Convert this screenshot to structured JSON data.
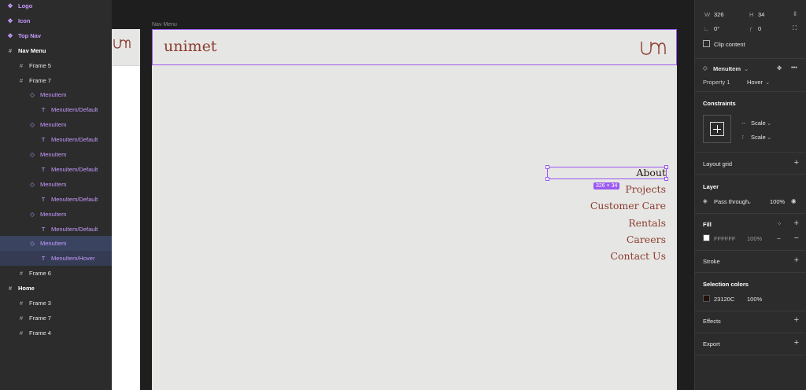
{
  "layers": {
    "items": [
      {
        "label": "Logo",
        "kind": "component",
        "indent": 0
      },
      {
        "label": "Icon",
        "kind": "component",
        "indent": 0
      },
      {
        "label": "Top Nav",
        "kind": "component",
        "indent": 0
      },
      {
        "label": "Nav Menu",
        "kind": "frame",
        "indent": 0
      },
      {
        "label": "Frame 5",
        "kind": "frame",
        "indent": 1
      },
      {
        "label": "Frame 7",
        "kind": "frame",
        "indent": 1
      },
      {
        "label": "MenuItem",
        "kind": "instance",
        "indent": 2
      },
      {
        "label": "MenuItem/Default",
        "kind": "text",
        "indent": 3
      },
      {
        "label": "MenuItem",
        "kind": "instance",
        "indent": 2
      },
      {
        "label": "MenuItem/Default",
        "kind": "text",
        "indent": 3
      },
      {
        "label": "MenuItem",
        "kind": "instance",
        "indent": 2
      },
      {
        "label": "MenuItem/Default",
        "kind": "text",
        "indent": 3
      },
      {
        "label": "MenuItem",
        "kind": "instance",
        "indent": 2
      },
      {
        "label": "MenuItem/Default",
        "kind": "text",
        "indent": 3
      },
      {
        "label": "MenuItem",
        "kind": "instance",
        "indent": 2
      },
      {
        "label": "MenuItem/Default",
        "kind": "text",
        "indent": 3
      },
      {
        "label": "MenuItem",
        "kind": "instance",
        "indent": 2
      },
      {
        "label": "MenuItem/Hover",
        "kind": "text",
        "indent": 3
      },
      {
        "label": "Frame 6",
        "kind": "frame",
        "indent": 1
      },
      {
        "label": "Home",
        "kind": "frame",
        "indent": 0
      },
      {
        "label": "Frame 3",
        "kind": "frame",
        "indent": 1
      },
      {
        "label": "Frame 7",
        "kind": "frame",
        "indent": 1
      },
      {
        "label": "Frame 4",
        "kind": "frame",
        "indent": 1
      }
    ]
  },
  "canvas": {
    "frame_label": "Nav Menu",
    "brand": "unimet",
    "logo_letters": "um",
    "menu": [
      "About",
      "Projects",
      "Customer Care",
      "Rentals",
      "Careers",
      "Contact Us"
    ],
    "size_badge": "326 × 34"
  },
  "props": {
    "w_label": "W",
    "w_value": "326",
    "h_label": "H",
    "h_value": "34",
    "rotation": "0°",
    "radius": "0",
    "clip_content": "Clip content",
    "component_name": "MenuItem",
    "property_label": "Property 1",
    "property_value": "Hover",
    "constraints_title": "Constraints",
    "constraint_h": "Scale",
    "constraint_v": "Scale",
    "layout_grid_title": "Layout grid",
    "layer_title": "Layer",
    "blend_mode": "Pass through",
    "layer_opacity": "100%",
    "fill_title": "Fill",
    "fill_hex": "FFFFFF",
    "fill_opacity": "100%",
    "stroke_title": "Stroke",
    "selection_colors_title": "Selection colors",
    "sel_color_hex": "23120C",
    "sel_color_opacity": "100%",
    "effects_title": "Effects",
    "export_title": "Export"
  },
  "colors": {
    "accent": "#9b59f0",
    "brand": "#8c3d2f",
    "hover_text": "#23120c"
  }
}
